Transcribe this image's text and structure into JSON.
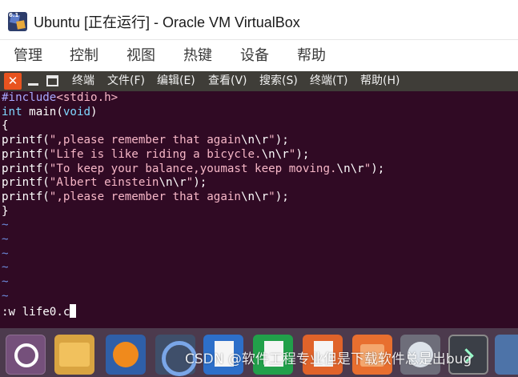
{
  "window": {
    "title": "Ubuntu [正在运行] - Oracle VM VirtualBox",
    "icon": "virtualbox-icon",
    "icon_badge": "6.1"
  },
  "menubar": {
    "items": [
      "管理",
      "控制",
      "视图",
      "热键",
      "设备",
      "帮助"
    ]
  },
  "terminal": {
    "titlebar_buttons": [
      "close",
      "minimize",
      "maximize"
    ],
    "close_glyph": "✕",
    "menu": [
      "终端",
      "文件(F)",
      "编辑(E)",
      "查看(V)",
      "搜索(S)",
      "终端(T)",
      "帮助(H)"
    ],
    "lines": [
      {
        "type": "pp",
        "text": "#include<stdio.h>"
      },
      {
        "type": "code",
        "text": "int main(void)"
      },
      {
        "type": "code",
        "text": "{"
      },
      {
        "type": "code",
        "text": "printf(\",please remember that again\\n\\r\");"
      },
      {
        "type": "code",
        "text": "printf(\"Life is like riding a bicycle.\\n\\r\");"
      },
      {
        "type": "code",
        "text": "printf(\"To keep your balance,youmast keep moving.\\n\\r\");"
      },
      {
        "type": "code",
        "text": "printf(\"Albert einstein\\n\\r\");"
      },
      {
        "type": "code",
        "text": "printf(\",please remember that again\\n\\r\");"
      },
      {
        "type": "code",
        "text": "}"
      },
      {
        "type": "tilde",
        "text": "~"
      },
      {
        "type": "tilde",
        "text": "~"
      },
      {
        "type": "tilde",
        "text": "~"
      },
      {
        "type": "tilde",
        "text": "~"
      },
      {
        "type": "tilde",
        "text": "~"
      },
      {
        "type": "tilde",
        "text": "~"
      }
    ],
    "command_line": ":w life0.c"
  },
  "dock": {
    "items": [
      "ubuntu-dash",
      "files",
      "firefox",
      "chromium",
      "libreoffice-writer",
      "libreoffice-calc",
      "libreoffice-impress",
      "ubuntu-software",
      "help",
      "terminal",
      "more"
    ]
  },
  "watermark": "CSDN @软件工程专业但是下载软件总是出bug",
  "colors": {
    "terminal_bg": "#300a24",
    "terminal_bar": "#3f3d38",
    "close_button": "#e8531f",
    "dock_bg": "#4c3a4d"
  }
}
